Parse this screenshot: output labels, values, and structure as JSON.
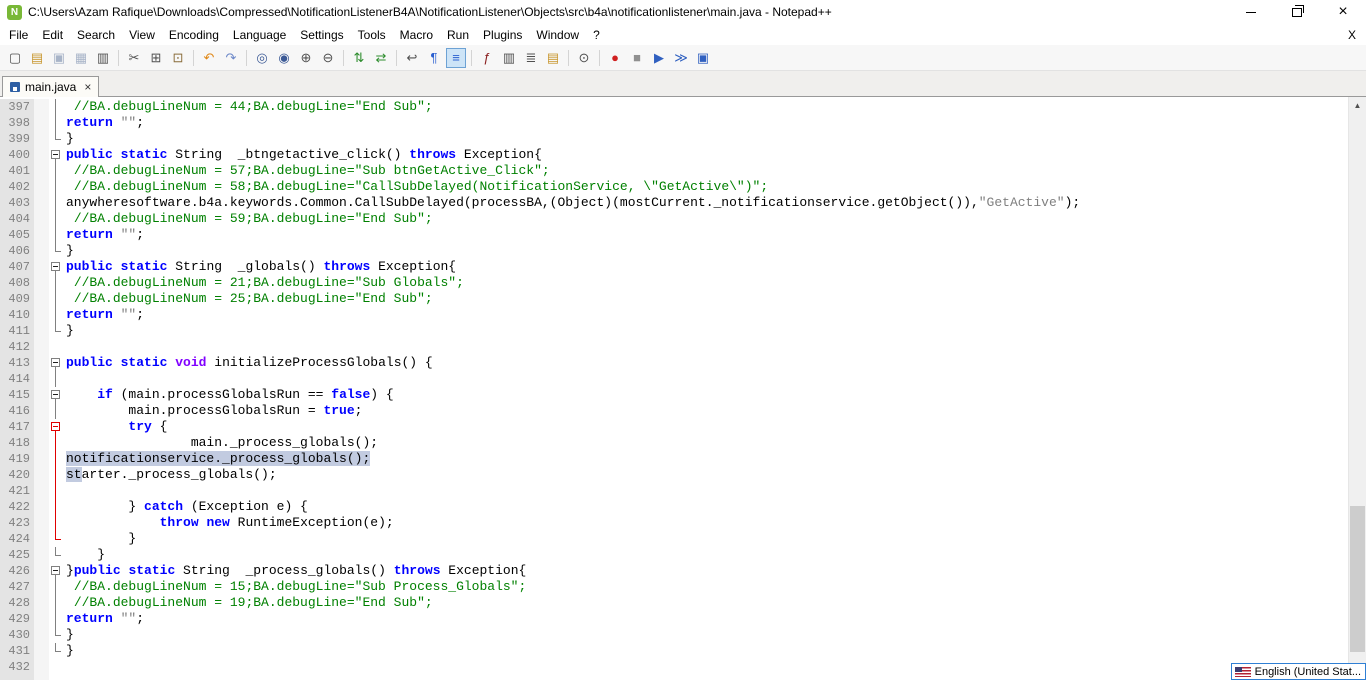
{
  "window": {
    "title": "C:\\Users\\Azam Rafique\\Downloads\\Compressed\\NotificationListenerB4A\\NotificationListener\\Objects\\src\\b4a\\notificationlistener\\main.java - Notepad++",
    "logo_letter": "N",
    "controls": {
      "minimize": "minimize",
      "maximize": "restore",
      "close": "×"
    }
  },
  "menu": {
    "items": [
      "File",
      "Edit",
      "Search",
      "View",
      "Encoding",
      "Language",
      "Settings",
      "Tools",
      "Macro",
      "Run",
      "Plugins",
      "Window",
      "?"
    ],
    "right_close": "X"
  },
  "toolbar": {
    "icons": [
      {
        "name": "new-file-icon",
        "glyph": "▢",
        "color": "#505050"
      },
      {
        "name": "open-folder-icon",
        "glyph": "▤",
        "color": "#c8962e"
      },
      {
        "name": "save-icon",
        "glyph": "▣",
        "color": "#a8b4c8"
      },
      {
        "name": "save-all-icon",
        "glyph": "▦",
        "color": "#a8b4c8"
      },
      {
        "name": "print-icon",
        "glyph": "▥",
        "color": "#505050"
      },
      {
        "sep": true
      },
      {
        "name": "cut-icon",
        "glyph": "✂",
        "color": "#505050"
      },
      {
        "name": "copy-icon",
        "glyph": "⊞",
        "color": "#505050"
      },
      {
        "name": "paste-icon",
        "glyph": "⊡",
        "color": "#8a6d3b"
      },
      {
        "sep": true
      },
      {
        "name": "undo-icon",
        "glyph": "↶",
        "color": "#e08818"
      },
      {
        "name": "redo-icon",
        "glyph": "↷",
        "color": "#6b87c8"
      },
      {
        "sep": true
      },
      {
        "name": "find-icon",
        "glyph": "◎",
        "color": "#3c5a96"
      },
      {
        "name": "replace-icon",
        "glyph": "◉",
        "color": "#3c5a96"
      },
      {
        "name": "zoom-in-icon",
        "glyph": "⊕",
        "color": "#505050"
      },
      {
        "name": "zoom-out-icon",
        "glyph": "⊖",
        "color": "#505050"
      },
      {
        "sep": true
      },
      {
        "name": "sync-vertical-icon",
        "glyph": "⇅",
        "color": "#2c8c2c"
      },
      {
        "name": "sync-horizontal-icon",
        "glyph": "⇄",
        "color": "#2c8c2c"
      },
      {
        "sep": true
      },
      {
        "name": "word-wrap-icon",
        "glyph": "↩",
        "color": "#505050"
      },
      {
        "name": "show-all-characters-icon",
        "glyph": "¶",
        "color": "#2a5fd0"
      },
      {
        "name": "indent-guide-icon",
        "glyph": "≡",
        "color": "#2a5fd0",
        "pressed": true
      },
      {
        "sep": true
      },
      {
        "name": "function-list-icon",
        "glyph": "ƒ",
        "color": "#8b2020"
      },
      {
        "name": "document-map-icon",
        "glyph": "▥",
        "color": "#505050"
      },
      {
        "name": "document-list-icon",
        "glyph": "≣",
        "color": "#505050"
      },
      {
        "name": "folder-as-workspace-icon",
        "glyph": "▤",
        "color": "#c8962e"
      },
      {
        "sep": true
      },
      {
        "name": "monitoring-eye-icon",
        "glyph": "⊙",
        "color": "#505050"
      },
      {
        "sep": true
      },
      {
        "name": "macro-record-icon",
        "glyph": "●",
        "color": "#d02020"
      },
      {
        "name": "macro-stop-icon",
        "glyph": "■",
        "color": "#909090"
      },
      {
        "name": "macro-play-icon",
        "glyph": "▶",
        "color": "#3060c0"
      },
      {
        "name": "macro-run-multiple-icon",
        "glyph": "≫",
        "color": "#3060c0"
      },
      {
        "name": "macro-save-icon",
        "glyph": "▣",
        "color": "#3060c0"
      }
    ]
  },
  "tabbar": {
    "tabs": [
      {
        "label": "main.java",
        "active": true,
        "close": "×"
      }
    ]
  },
  "editor": {
    "selection_color": "#c2cbe0",
    "lines": [
      {
        "num": 397,
        "fold": "v",
        "tokens": [
          [
            "d",
            " "
          ],
          [
            "c",
            "//BA.debugLineNum = 44;BA.debugLine=\"End Sub\";"
          ]
        ]
      },
      {
        "num": 398,
        "fold": "v",
        "tokens": [
          [
            "k",
            "return"
          ],
          [
            "d",
            " "
          ],
          [
            "s",
            "\"\""
          ],
          [
            "d",
            ";"
          ]
        ]
      },
      {
        "num": 399,
        "fold": "e",
        "tokens": [
          [
            "d",
            "}"
          ]
        ]
      },
      {
        "num": 400,
        "fold": "b",
        "tokens": [
          [
            "k",
            "public"
          ],
          [
            "d",
            " "
          ],
          [
            "k",
            "static"
          ],
          [
            "d",
            " String  _btngetactive_click() "
          ],
          [
            "k",
            "throws"
          ],
          [
            "d",
            " Exception{"
          ]
        ]
      },
      {
        "num": 401,
        "fold": "v",
        "tokens": [
          [
            "d",
            " "
          ],
          [
            "c",
            "//BA.debugLineNum = 57;BA.debugLine=\"Sub btnGetActive_Click\";"
          ]
        ]
      },
      {
        "num": 402,
        "fold": "v",
        "tokens": [
          [
            "d",
            " "
          ],
          [
            "c",
            "//BA.debugLineNum = 58;BA.debugLine=\"CallSubDelayed(NotificationService, \\\"GetActive\\\")\";"
          ]
        ]
      },
      {
        "num": 403,
        "fold": "v",
        "tokens": [
          [
            "d",
            "anywheresoftware.b4a.keywords.Common.CallSubDelayed(processBA,(Object)(mostCurrent._notificationservice.getObject()),"
          ],
          [
            "s",
            "\"GetActive\""
          ],
          [
            "d",
            ");"
          ]
        ]
      },
      {
        "num": 404,
        "fold": "v",
        "tokens": [
          [
            "d",
            " "
          ],
          [
            "c",
            "//BA.debugLineNum = 59;BA.debugLine=\"End Sub\";"
          ]
        ]
      },
      {
        "num": 405,
        "fold": "v",
        "tokens": [
          [
            "k",
            "return"
          ],
          [
            "d",
            " "
          ],
          [
            "s",
            "\"\""
          ],
          [
            "d",
            ";"
          ]
        ]
      },
      {
        "num": 406,
        "fold": "e",
        "tokens": [
          [
            "d",
            "}"
          ]
        ]
      },
      {
        "num": 407,
        "fold": "b",
        "tokens": [
          [
            "k",
            "public"
          ],
          [
            "d",
            " "
          ],
          [
            "k",
            "static"
          ],
          [
            "d",
            " String  _globals() "
          ],
          [
            "k",
            "throws"
          ],
          [
            "d",
            " Exception{"
          ]
        ]
      },
      {
        "num": 408,
        "fold": "v",
        "tokens": [
          [
            "d",
            " "
          ],
          [
            "c",
            "//BA.debugLineNum = 21;BA.debugLine=\"Sub Globals\";"
          ]
        ]
      },
      {
        "num": 409,
        "fold": "v",
        "tokens": [
          [
            "d",
            " "
          ],
          [
            "c",
            "//BA.debugLineNum = 25;BA.debugLine=\"End Sub\";"
          ]
        ]
      },
      {
        "num": 410,
        "fold": "v",
        "tokens": [
          [
            "k",
            "return"
          ],
          [
            "d",
            " "
          ],
          [
            "s",
            "\"\""
          ],
          [
            "d",
            ";"
          ]
        ]
      },
      {
        "num": 411,
        "fold": "e",
        "tokens": [
          [
            "d",
            "}"
          ]
        ]
      },
      {
        "num": 412,
        "fold": "",
        "tokens": []
      },
      {
        "num": 413,
        "fold": "b",
        "tokens": [
          [
            "k",
            "public"
          ],
          [
            "d",
            " "
          ],
          [
            "k",
            "static"
          ],
          [
            "d",
            " "
          ],
          [
            "t",
            "void"
          ],
          [
            "d",
            " initializeProcessGlobals() {"
          ]
        ]
      },
      {
        "num": 414,
        "fold": "v",
        "tokens": []
      },
      {
        "num": 415,
        "fold": "b",
        "tokens": [
          [
            "d",
            "    "
          ],
          [
            "k",
            "if"
          ],
          [
            "d",
            " (main.processGlobalsRun == "
          ],
          [
            "k",
            "false"
          ],
          [
            "d",
            ") {"
          ]
        ]
      },
      {
        "num": 416,
        "fold": "v",
        "tokens": [
          [
            "d",
            "        main.processGlobalsRun = "
          ],
          [
            "k",
            "true"
          ],
          [
            "d",
            ";"
          ]
        ]
      },
      {
        "num": 417,
        "fold": "br",
        "tokens": [
          [
            "d",
            "        "
          ],
          [
            "k",
            "try"
          ],
          [
            "d",
            " {"
          ]
        ]
      },
      {
        "num": 418,
        "fold": "vr",
        "tokens": [
          [
            "d",
            "                main._process_globals();"
          ]
        ]
      },
      {
        "num": 419,
        "fold": "vr",
        "tokens": [
          [
            "sel",
            "notificationservice._process_globals();"
          ]
        ]
      },
      {
        "num": 420,
        "fold": "vr",
        "tokens": [
          [
            "sel",
            "st"
          ],
          [
            "d",
            "arter._process_globals();"
          ]
        ]
      },
      {
        "num": 421,
        "fold": "vr",
        "tokens": []
      },
      {
        "num": 422,
        "fold": "vr",
        "tokens": [
          [
            "d",
            "        } "
          ],
          [
            "k",
            "catch"
          ],
          [
            "d",
            " (Exception e) {"
          ]
        ]
      },
      {
        "num": 423,
        "fold": "vr",
        "tokens": [
          [
            "d",
            "            "
          ],
          [
            "k",
            "throw"
          ],
          [
            "d",
            " "
          ],
          [
            "k",
            "new"
          ],
          [
            "d",
            " RuntimeException(e);"
          ]
        ]
      },
      {
        "num": 424,
        "fold": "er",
        "tokens": [
          [
            "d",
            "        }"
          ]
        ]
      },
      {
        "num": 425,
        "fold": "e",
        "tokens": [
          [
            "d",
            "    }"
          ]
        ]
      },
      {
        "num": 426,
        "fold": "b",
        "tokens": [
          [
            "d",
            "}"
          ],
          [
            "k",
            "public"
          ],
          [
            "d",
            " "
          ],
          [
            "k",
            "static"
          ],
          [
            "d",
            " String  _process_globals() "
          ],
          [
            "k",
            "throws"
          ],
          [
            "d",
            " Exception{"
          ]
        ]
      },
      {
        "num": 427,
        "fold": "v",
        "tokens": [
          [
            "d",
            " "
          ],
          [
            "c",
            "//BA.debugLineNum = 15;BA.debugLine=\"Sub Process_Globals\";"
          ]
        ]
      },
      {
        "num": 428,
        "fold": "v",
        "tokens": [
          [
            "d",
            " "
          ],
          [
            "c",
            "//BA.debugLineNum = 19;BA.debugLine=\"End Sub\";"
          ]
        ]
      },
      {
        "num": 429,
        "fold": "v",
        "tokens": [
          [
            "k",
            "return"
          ],
          [
            "d",
            " "
          ],
          [
            "s",
            "\"\""
          ],
          [
            "d",
            ";"
          ]
        ]
      },
      {
        "num": 430,
        "fold": "e",
        "tokens": [
          [
            "d",
            "}"
          ]
        ]
      },
      {
        "num": 431,
        "fold": "e",
        "tokens": [
          [
            "d",
            "}"
          ]
        ]
      },
      {
        "num": 432,
        "fold": "",
        "tokens": []
      }
    ]
  },
  "scrollbar": {
    "up": "▲",
    "down": "▼",
    "thumb_top_pct": 70,
    "thumb_height_pct": 25
  },
  "language_bar": {
    "label": "English (United Stat..."
  }
}
